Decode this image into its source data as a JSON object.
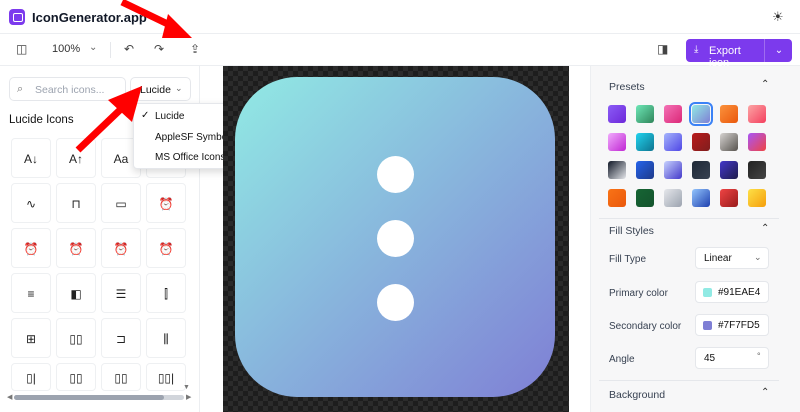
{
  "app": {
    "title": "IconGenerator.app"
  },
  "icons": {
    "logo": "app-logo",
    "theme": "sun-icon",
    "panel_toggle": "panel-left-icon",
    "undo": "undo-icon",
    "redo": "redo-icon",
    "upload": "upload-icon",
    "panel_right": "panel-right-icon",
    "export": "download-icon",
    "search": "search-icon",
    "chevron": "chevron-down-icon",
    "check": "check-icon"
  },
  "toolbar": {
    "zoom": "100%",
    "export_label": "Export icon"
  },
  "left": {
    "search_placeholder": "Search icons...",
    "library_selected": "Lucide",
    "section_title": "Lucide Icons",
    "library_options": [
      "Lucide",
      "AppleSF Symbols",
      "MS Office Icons"
    ],
    "grid_icons": [
      {
        "name": "arrow-down-a-z-icon",
        "glyph": "A↓"
      },
      {
        "name": "arrow-up-a-z-icon",
        "glyph": "A↑"
      },
      {
        "name": "text-size-icon",
        "glyph": "Aa"
      },
      {
        "name": "blank-icon",
        "glyph": ""
      },
      {
        "name": "activity-icon",
        "glyph": "∿"
      },
      {
        "name": "air-vent-icon",
        "glyph": "⊓"
      },
      {
        "name": "airplay-icon",
        "glyph": "▭"
      },
      {
        "name": "alarm-clock-icon",
        "glyph": "⏰"
      },
      {
        "name": "alarm-check-icon",
        "glyph": "⏰"
      },
      {
        "name": "alarm-minus-icon",
        "glyph": "⏰"
      },
      {
        "name": "alarm-off-icon",
        "glyph": "⏰"
      },
      {
        "name": "alarm-plus-icon",
        "glyph": "⏰"
      },
      {
        "name": "air-vent-2-icon",
        "glyph": "≡"
      },
      {
        "name": "album-icon",
        "glyph": "◧"
      },
      {
        "name": "align-center-icon",
        "glyph": "☰"
      },
      {
        "name": "align-center-horizontal-icon",
        "glyph": "⫿"
      },
      {
        "name": "align-center-vertical-icon",
        "glyph": "⊞"
      },
      {
        "name": "align-end-horizontal-icon",
        "glyph": "▯▯"
      },
      {
        "name": "align-end-vertical-icon",
        "glyph": "⊐"
      },
      {
        "name": "align-horizontal-distribute-center-icon",
        "glyph": "⫼"
      },
      {
        "name": "align-horizontal-justify-icon",
        "glyph": "▯|"
      },
      {
        "name": "align-horizontal-space-icon",
        "glyph": "▯▯"
      },
      {
        "name": "align-vertical-icon",
        "glyph": "▯▯"
      },
      {
        "name": "align-vertical-space-icon",
        "glyph": "▯▯|"
      }
    ]
  },
  "presets": {
    "title": "Presets",
    "swatches": [
      "linear-gradient(135deg,#8b5cf6,#6d28d9)",
      "linear-gradient(135deg,#6ee7b7,#2f855a)",
      "linear-gradient(135deg,#f472b6,#db2777)",
      "linear-gradient(135deg,#91EAE4,#7F7FD5)",
      "linear-gradient(135deg,#fb923c,#ea580c)",
      "linear-gradient(135deg,#fca5a5,#f43f5e)",
      "linear-gradient(135deg,#f0abfc,#c026d3)",
      "linear-gradient(135deg,#22d3ee,#0e7490)",
      "linear-gradient(135deg,#a5b4fc,#4f46e5)",
      "linear-gradient(135deg,#b91c1c,#7f1d1d)",
      "linear-gradient(135deg,#d6d3d1,#57534e)",
      "linear-gradient(135deg,#a855f7,#ef4444)",
      "linear-gradient(135deg,#111827,#e5e7eb)",
      "linear-gradient(135deg,#2563eb,#1e3a8a)",
      "linear-gradient(135deg,#c7d2fe,#4338ca)",
      "linear-gradient(135deg,#1f2937,#374151)",
      "linear-gradient(135deg,#4338ca,#1e1b4b)",
      "linear-gradient(135deg,#222,#444)",
      "linear-gradient(135deg,#f97316,#ea580c)",
      "linear-gradient(135deg,#166534,#14532d)",
      "linear-gradient(135deg,#e5e7eb,#9ca3af)",
      "linear-gradient(135deg,#93c5fd,#1e40af)",
      "linear-gradient(135deg,#ef4444,#991b1b)",
      "linear-gradient(135deg,#fde047,#f59e0b)"
    ],
    "selected_index": 3
  },
  "fill": {
    "title": "Fill Styles",
    "fill_type_label": "Fill Type",
    "fill_type": "Linear",
    "primary_label": "Primary color",
    "primary": "#91EAE4",
    "secondary_label": "Secondary color",
    "secondary": "#7F7FD5",
    "angle_label": "Angle",
    "angle": "45",
    "angle_unit": "°"
  },
  "background": {
    "title": "Background"
  }
}
